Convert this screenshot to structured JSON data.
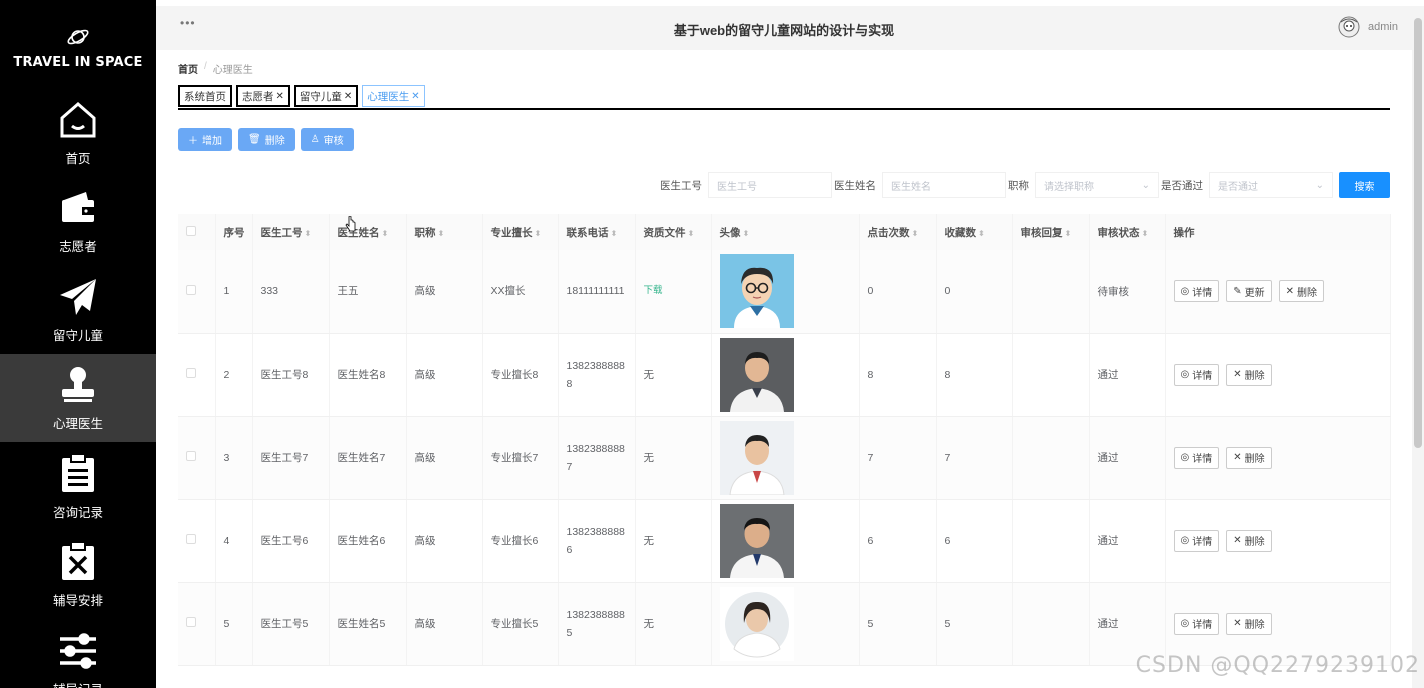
{
  "brand": {
    "name": "TRAVEL IN SPACE"
  },
  "sidebar": {
    "items": [
      {
        "label": "首页",
        "icon": "home-icon"
      },
      {
        "label": "志愿者",
        "icon": "wallet-icon"
      },
      {
        "label": "留守儿童",
        "icon": "paper-plane-icon"
      },
      {
        "label": "心理医生",
        "icon": "stamp-icon",
        "active": true
      },
      {
        "label": "咨询记录",
        "icon": "clipboard-list-icon"
      },
      {
        "label": "辅导安排",
        "icon": "clipboard-x-icon"
      },
      {
        "label": "辅导记录",
        "icon": "sliders-icon"
      }
    ]
  },
  "header": {
    "menu": "•••",
    "title": "基于web的留守儿童网站的设计与实现",
    "user": "admin"
  },
  "breadcrumb": {
    "home": "首页",
    "sep": "/",
    "current": "心理医生"
  },
  "tabs": [
    {
      "label": "系统首页",
      "closable": false
    },
    {
      "label": "志愿者",
      "closable": true
    },
    {
      "label": "留守儿童",
      "closable": true
    },
    {
      "label": "心理医生",
      "closable": true,
      "active": true
    }
  ],
  "actions": {
    "add": "增加",
    "delete": "删除",
    "audit": "审核"
  },
  "search": {
    "doctor_id_label": "医生工号",
    "doctor_id_placeholder": "医生工号",
    "doctor_name_label": "医生姓名",
    "doctor_name_placeholder": "医生姓名",
    "title_label": "职称",
    "title_placeholder": "请选择职称",
    "passed_label": "是否通过",
    "passed_placeholder": "是否通过",
    "button": "搜索"
  },
  "table": {
    "columns": [
      "序号",
      "医生工号",
      "医生姓名",
      "职称",
      "专业擅长",
      "联系电话",
      "资质文件",
      "头像",
      "点击次数",
      "收藏数",
      "审核回复",
      "审核状态",
      "操作"
    ],
    "rows": [
      {
        "no": "1",
        "id": "333",
        "name": "王五",
        "title": "高级",
        "specialty": "XX擅长",
        "phone": "18111111111",
        "file": "下载",
        "clicks": "0",
        "favorites": "0",
        "reply": "",
        "status": "待审核",
        "ops": [
          "详情",
          "更新",
          "删除"
        ]
      },
      {
        "no": "2",
        "id": "医生工号8",
        "name": "医生姓名8",
        "title": "高级",
        "specialty": "专业擅长8",
        "phone": "13823888888",
        "file": "无",
        "clicks": "8",
        "favorites": "8",
        "reply": "",
        "status": "通过",
        "ops": [
          "详情",
          "删除"
        ]
      },
      {
        "no": "3",
        "id": "医生工号7",
        "name": "医生姓名7",
        "title": "高级",
        "specialty": "专业擅长7",
        "phone": "13823888887",
        "file": "无",
        "clicks": "7",
        "favorites": "7",
        "reply": "",
        "status": "通过",
        "ops": [
          "详情",
          "删除"
        ]
      },
      {
        "no": "4",
        "id": "医生工号6",
        "name": "医生姓名6",
        "title": "高级",
        "specialty": "专业擅长6",
        "phone": "13823888886",
        "file": "无",
        "clicks": "6",
        "favorites": "6",
        "reply": "",
        "status": "通过",
        "ops": [
          "详情",
          "删除"
        ]
      },
      {
        "no": "5",
        "id": "医生工号5",
        "name": "医生姓名5",
        "title": "高级",
        "specialty": "专业擅长5",
        "phone": "13823888885",
        "file": "无",
        "clicks": "5",
        "favorites": "5",
        "reply": "",
        "status": "通过",
        "ops": [
          "详情",
          "删除"
        ]
      }
    ]
  },
  "watermark": "CSDN @QQ2279239102",
  "colors": {
    "primary": "#1890ff",
    "button": "#6aa8f5",
    "sidebar": "#000000",
    "active_item": "#3a3a3a",
    "download": "#35b58c"
  }
}
